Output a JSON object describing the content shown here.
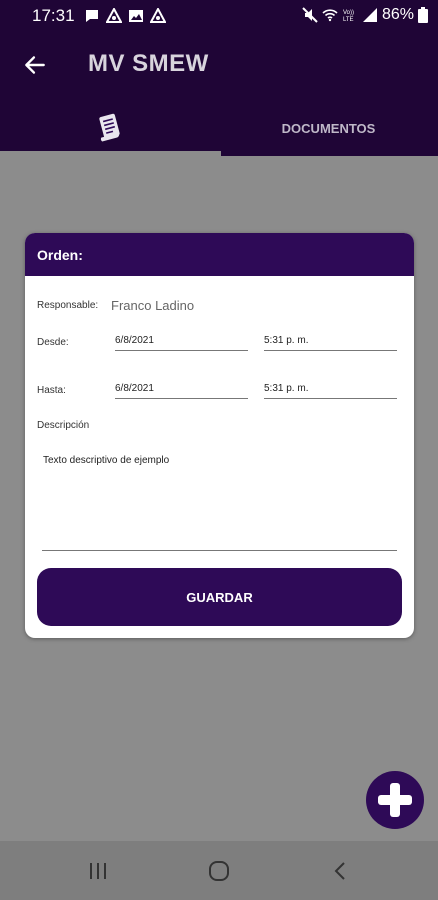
{
  "status_bar": {
    "time": "17:31",
    "battery": "86%",
    "icons": [
      "chat-icon",
      "data-saver-icon",
      "image-icon",
      "data-saver-icon",
      "mute-icon",
      "wifi-icon",
      "volte-icon",
      "signal-icon",
      "battery-icon"
    ]
  },
  "app_bar": {
    "title": "MV SMEW",
    "back_icon": "arrow-back-icon"
  },
  "tabs": [
    {
      "icon": "document-list-icon",
      "label": "",
      "active": true
    },
    {
      "label": "DOCUMENTOS",
      "active": false
    }
  ],
  "card": {
    "title": "Orden:",
    "responsable_label": "Responsable:",
    "responsable_value": "Franco Ladino",
    "desde_label": "Desde:",
    "desde_date": "6/8/2021",
    "desde_time": "5:31 p. m.",
    "hasta_label": "Hasta:",
    "hasta_date": "6/8/2021",
    "hasta_time": "5:31 p. m.",
    "descripcion_label": "Descripción",
    "descripcion_value": "Texto descriptivo de ejemplo",
    "save_label": "GUARDAR"
  },
  "fab": {
    "icon": "add-icon"
  },
  "nav_bar": {
    "icons": [
      "recent-apps-icon",
      "home-icon",
      "back-nav-icon"
    ]
  },
  "colors": {
    "primary_dark": "#1f0536",
    "primary": "#2e0a57",
    "background": "#8c8c8c"
  }
}
